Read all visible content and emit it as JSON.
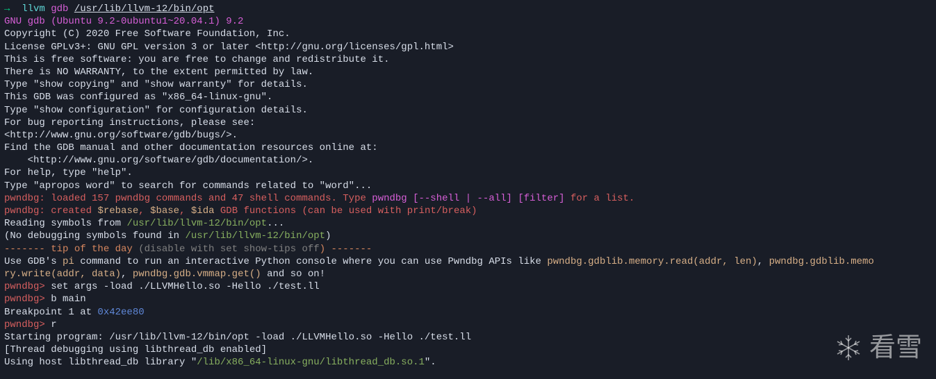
{
  "prompt": {
    "arrow": "→",
    "cmd1": "llvm",
    "cmd2": "gdb",
    "path": "/usr/lib/llvm-12/bin/opt"
  },
  "banner": "GNU gdb (Ubuntu 9.2-0ubuntu1~20.04.1) 9.2",
  "copyright": [
    "Copyright (C) 2020 Free Software Foundation, Inc.",
    "License GPLv3+: GNU GPL version 3 or later <http://gnu.org/licenses/gpl.html>",
    "This is free software: you are free to change and redistribute it.",
    "There is NO WARRANTY, to the extent permitted by law.",
    "Type \"show copying\" and \"show warranty\" for details.",
    "This GDB was configured as \"x86_64-linux-gnu\".",
    "Type \"show configuration\" for configuration details.",
    "For bug reporting instructions, please see:",
    "<http://www.gnu.org/software/gdb/bugs/>.",
    "Find the GDB manual and other documentation resources online at:",
    "    <http://www.gnu.org/software/gdb/documentation/>.",
    "",
    "For help, type \"help\".",
    "Type \"apropos word\" to search for commands related to \"word\"..."
  ],
  "pwndbg": {
    "label": "pwndbg:",
    "loaded1": " loaded 157 pwndbg commands and 47 shell commands. Type ",
    "loaded2": "pwndbg [--shell | --all] [filter]",
    "loaded3": " for a list.",
    "created1": " created ",
    "rebase": "$rebase",
    "comma1": ", ",
    "base": "$base",
    "comma2": ", ",
    "ida": "$ida",
    "created2": " GDB functions (can be used with print/break)"
  },
  "reading": {
    "pre": "Reading symbols from ",
    "path": "/usr/lib/llvm-12/bin/opt",
    "post": "..."
  },
  "nodebug": {
    "pre": "(No debugging symbols found in ",
    "path": "/usr/lib/llvm-12/bin/opt",
    "post": ")"
  },
  "tip": {
    "dashes1": "------- ",
    "label": "tip of the day",
    "disable": " (disable with ",
    "cmd": "set show-tips off",
    "dashes2": ") -------"
  },
  "tipbody": {
    "p1": "Use GDB's ",
    "pi": "pi",
    "p2": " command to run an interactive Python console where you can use Pwndbg APIs like ",
    "api1": "pwndbg.gdblib.memory.read(addr, len)",
    "c1": ", ",
    "api2a": "pwndbg.gdblib.memo",
    "api2b": "ry.write(addr, data)",
    "c2": ", ",
    "api3": "pwndbg.gdb.vmmap.get()",
    "p3": " and so on!"
  },
  "cmds": {
    "prompt": "pwndbg>",
    "setargs": " set args -load ./LLVMHello.so -Hello ./test.ll",
    "bmain": " b main",
    "bp": {
      "pre": "Breakpoint 1 at ",
      "addr": "0x42ee80"
    },
    "r": " r",
    "start": "Starting program: /usr/lib/llvm-12/bin/opt -load ./LLVMHello.so -Hello ./test.ll",
    "thread": "[Thread debugging using libthread_db enabled]",
    "host": {
      "pre": "Using host libthread_db library \"",
      "path": "/lib/x86_64-linux-gnu/libthread_db.so.1",
      "post": "\"."
    }
  },
  "watermark": "看雪"
}
